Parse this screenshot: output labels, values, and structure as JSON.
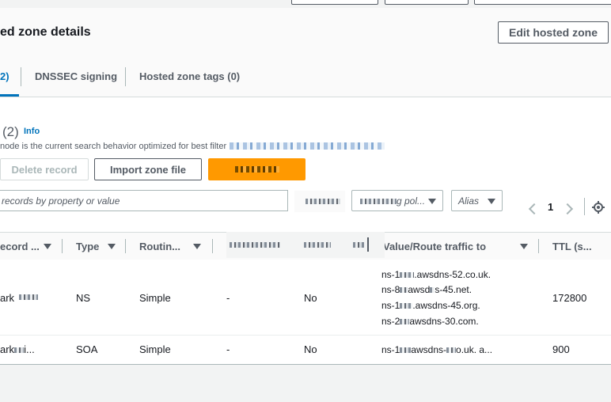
{
  "header": {
    "details_title": "ed zone details",
    "edit_button": "Edit hosted zone"
  },
  "tabs": [
    {
      "label": "2)",
      "active": true
    },
    {
      "label": "DNSSEC signing",
      "active": false
    },
    {
      "label": "Hosted zone tags (0)",
      "active": false
    }
  ],
  "records": {
    "count_label": "(2)",
    "info_label": "Info",
    "search_note": "node is the current search behavior optimized for best filter",
    "delete_button": "Delete record",
    "import_button": "Import zone file",
    "search_placeholder": "records by property or value",
    "routing_filter": "g pol...",
    "alias_filter": "Alias",
    "page_number": "1"
  },
  "table": {
    "columns": [
      "ecord ...",
      "Type",
      "Routin...",
      "Value/Route traffic to",
      "TTL (s..."
    ],
    "rows": [
      {
        "name": "ark",
        "type": "NS",
        "routing": "Simple",
        "differentiator": "-",
        "alias": "No",
        "values": [
          "ns-1",
          "ns-8",
          "ns-1",
          "ns-2"
        ],
        "value_suffixes": [
          ".awsdns-52.co.uk.",
          "awsd",
          "s-45.net.",
          ".awsdns-45.org.",
          "awsdns-30.com."
        ],
        "ttl": "172800"
      },
      {
        "name": "ark",
        "name_suffix": "i...",
        "type": "SOA",
        "routing": "Simple",
        "differentiator": "-",
        "alias": "No",
        "value": "ns-1",
        "value_suffix": "awsdns-",
        "value_end": "o.uk. a...",
        "ttl": "900"
      }
    ]
  },
  "colors": {
    "accent": "#0073bb",
    "primary": "#ff9900"
  }
}
